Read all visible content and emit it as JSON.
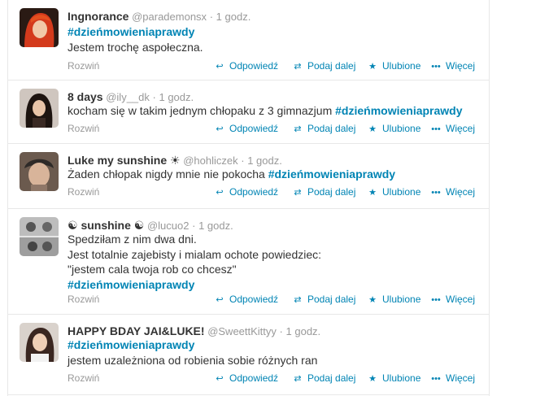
{
  "actions": {
    "expand": "Rozwiń",
    "reply": "Odpowiedź",
    "retweet": "Podaj dalej",
    "favorite": "Ulubione",
    "more": "Więcej"
  },
  "tweets": [
    {
      "fullname": "Ingnorance",
      "username": "@parademonsx",
      "time": "1 godz.",
      "hashtag_line": "#dzieńmowieniaprawdy",
      "text": "Jestem trochę aspołeczna."
    },
    {
      "fullname": "8 days",
      "username": "@ily__dk",
      "time": "1 godz.",
      "text": "kocham się w takim jednym chłopaku z 3 gimnazjum",
      "hashtag": "#dzieńmowieniaprawdy"
    },
    {
      "fullname": "Luke my sunshine ☀",
      "username": "@hohliczek",
      "time": "1 godz.",
      "text": "Żaden chłopak nigdy mnie nie pokocha",
      "hashtag": "#dzieńmowieniaprawdy"
    },
    {
      "fullname": "☯ sunshine ☯",
      "username": "@lucuo2",
      "time": "1 godz.",
      "lines": [
        "Spedziłam z nim dwa dni.",
        "Jest totalnie zajebisty i mialam ochote powiedziec:",
        "\"jestem cala twoja rob co chcesz\""
      ],
      "hashtag": "#dzieńmowieniaprawdy"
    },
    {
      "fullname": "HAPPY BDAY JAI&LUKE!",
      "username": "@SweettKittyy",
      "time": "1 godz.",
      "hashtag_line": "#dzieńmowieniaprawdy",
      "text": "jestem uzależniona od robienia sobie różnych ran"
    }
  ],
  "colors": {
    "link": "#0084b4",
    "muted": "#999999",
    "text": "#333333",
    "border": "#e8e8e8"
  },
  "icons": {
    "reply": "reply-arrow-icon",
    "retweet": "retweet-icon",
    "favorite": "star-icon",
    "more": "dots-icon"
  }
}
